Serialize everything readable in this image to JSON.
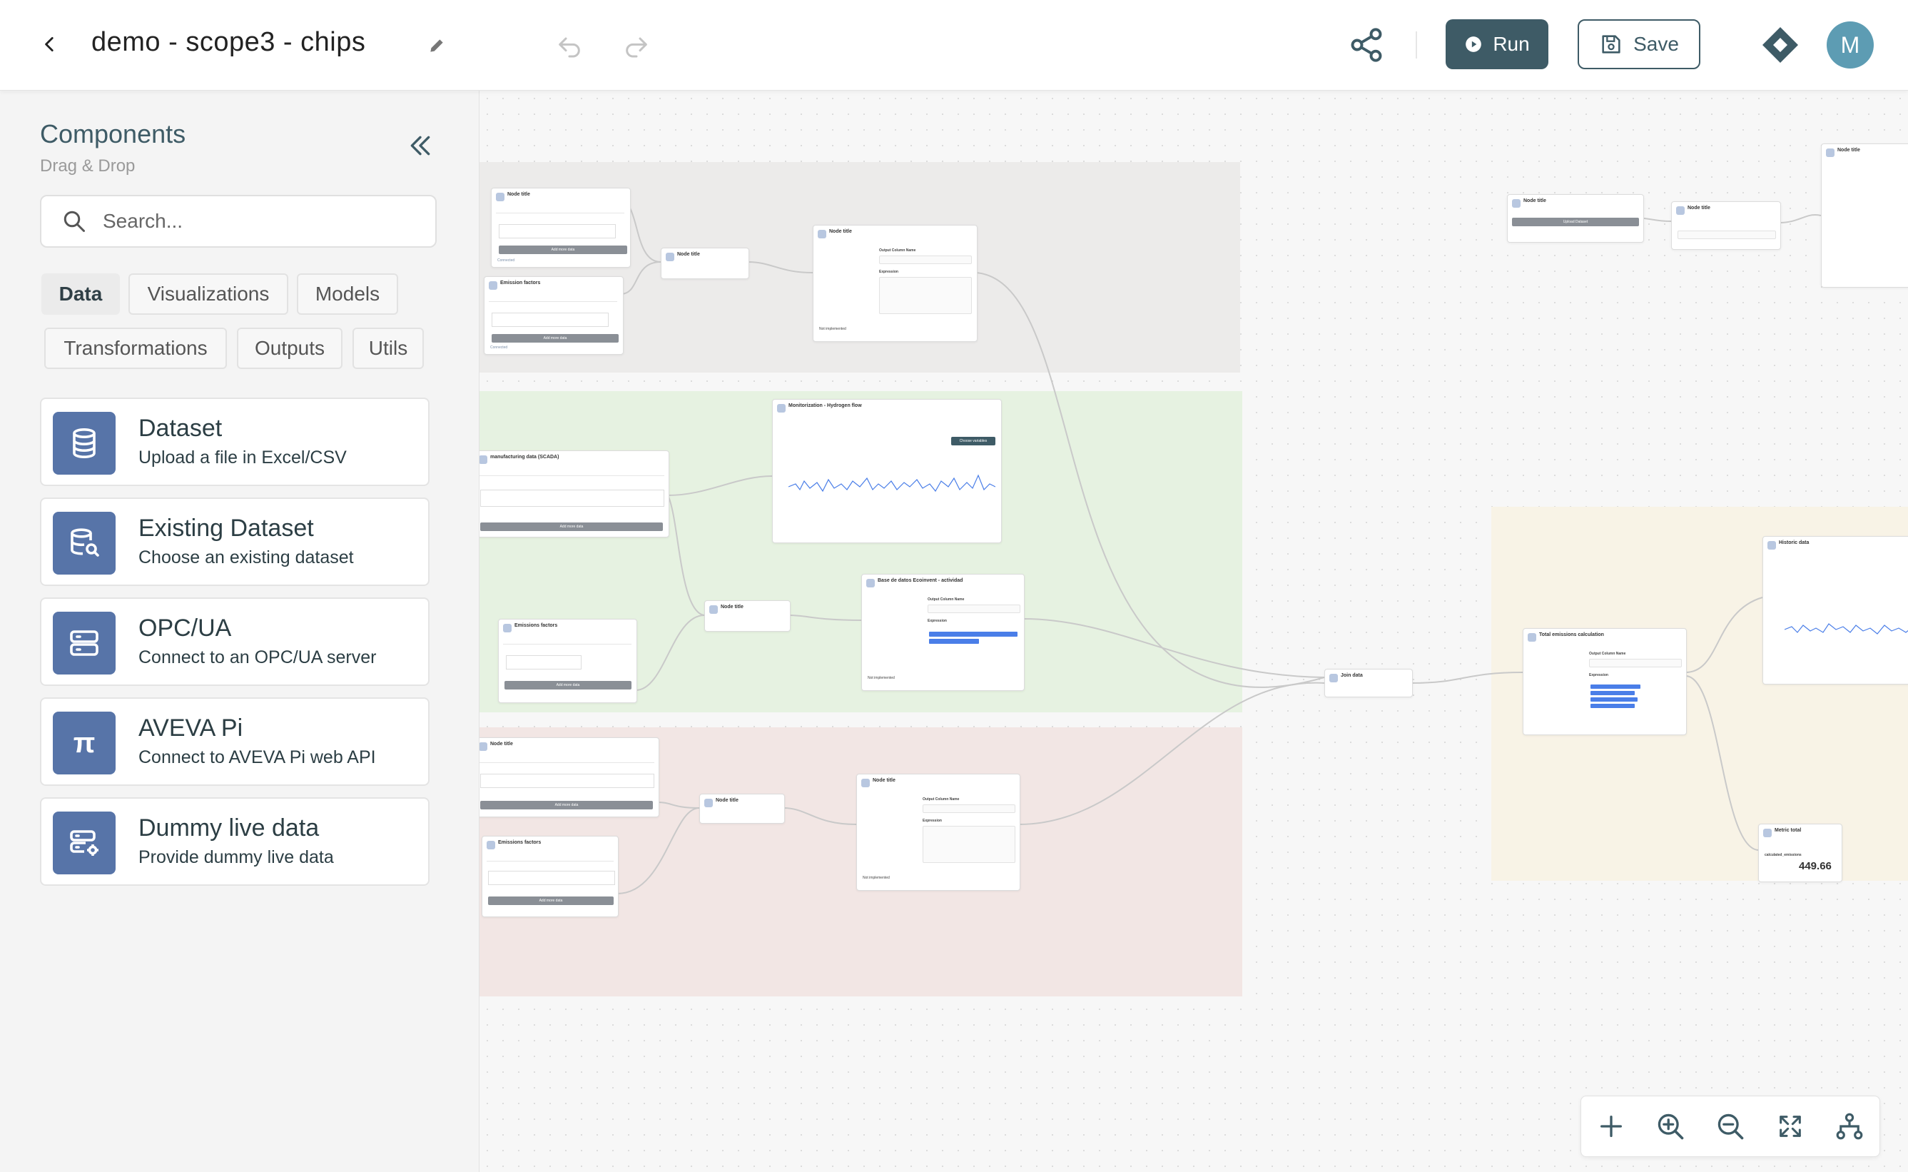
{
  "header": {
    "title": "demo - scope3 - chips",
    "run_label": "Run",
    "save_label": "Save",
    "avatar_initial": "M"
  },
  "sidebar": {
    "title": "Components",
    "subtitle": "Drag & Drop",
    "search_placeholder": "Search...",
    "tabs": [
      "Data",
      "Visualizations",
      "Models",
      "Transformations",
      "Outputs",
      "Utils"
    ],
    "active_tab": "Data",
    "components": [
      {
        "name": "Dataset",
        "desc": "Upload a file in Excel/CSV",
        "icon": "database-icon"
      },
      {
        "name": "Existing Dataset",
        "desc": "Choose an existing dataset",
        "icon": "database-search-icon"
      },
      {
        "name": "OPC/UA",
        "desc": "Connect to an OPC/UA server",
        "icon": "server-icon"
      },
      {
        "name": "AVEVA Pi",
        "desc": "Connect to AVEVA Pi web API",
        "icon": "pi-icon",
        "glyph": "π"
      },
      {
        "name": "Dummy live data",
        "desc": "Provide dummy live data",
        "icon": "server-gear-icon"
      }
    ]
  },
  "canvas": {
    "nodes": {
      "node_title": "Node title",
      "emission_factors": "Emission factors",
      "emissions_factors": "Emissions factors",
      "manufacturing_data": "manufacturing data (SCADA)",
      "monitorization": "Monitorization - Hydrogen flow",
      "ecoinvent": "Base de datos Ecoinvent - actividad",
      "join_data": "Join data",
      "total_emissions": "Total emissions calculation",
      "historic_data": "Historic data",
      "metric_total": "Metric total",
      "add_more_data": "Add more data",
      "upload_dataset": "Upload Dataset",
      "choose_variables": "Choose variables",
      "output_column_name": "Output Column Name",
      "expression": "Expression",
      "connected": "Connected",
      "not_implemented": "Not implemented",
      "metric_value": "449.66",
      "metric_field": "calculated_emissions"
    }
  },
  "colors": {
    "accent": "#3e5b66",
    "component_icon": "#5774a8",
    "avatar": "#5d9cb3",
    "group_gray": "#ecebea",
    "group_green": "#e6f2e1",
    "group_red": "#f2e6e4",
    "group_yellow": "#f8f3e6"
  }
}
